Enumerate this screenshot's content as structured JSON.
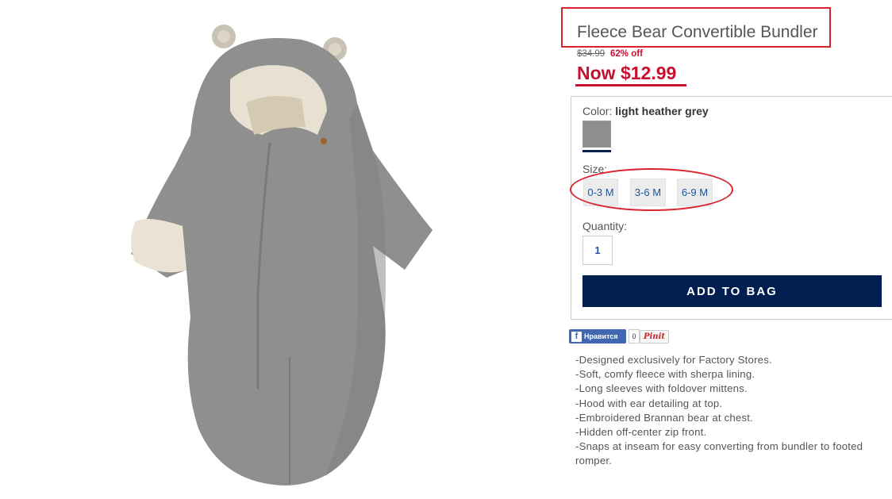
{
  "product": {
    "title": "Fleece Bear Convertible Bundler",
    "old_price": "$34.99",
    "discount": "62% off",
    "now_price": "Now $12.99",
    "image_icon": "fleece-bundler-photo"
  },
  "options": {
    "color_label": "Color:",
    "color_value": "light heather grey",
    "swatch_color": "#8e8e8e",
    "size_label": "Size:",
    "sizes": [
      "0-3 M",
      "3-6 M",
      "6-9 M"
    ],
    "quantity_label": "Quantity:",
    "quantity_value": "1",
    "add_to_bag": "ADD TO BAG"
  },
  "social": {
    "fb_icon": "f",
    "fb_like": "Нравится",
    "fb_count": "0",
    "pinterest": "Pinit"
  },
  "description": [
    "-Designed exclusively for Factory Stores.",
    "-Soft, comfy fleece with sherpa lining.",
    "-Long sleeves with foldover mittens.",
    "-Hood with ear detailing at top.",
    "-Embroidered Brannan bear at chest.",
    "-Hidden off-center zip front.",
    "-Snaps at inseam for easy converting from bundler to footed romper."
  ],
  "colors": {
    "accent_red": "#c8102e",
    "annotation_red": "#d9232d",
    "navy": "#001e50",
    "link_blue": "#1a56a0",
    "facebook_blue": "#4267b2"
  }
}
